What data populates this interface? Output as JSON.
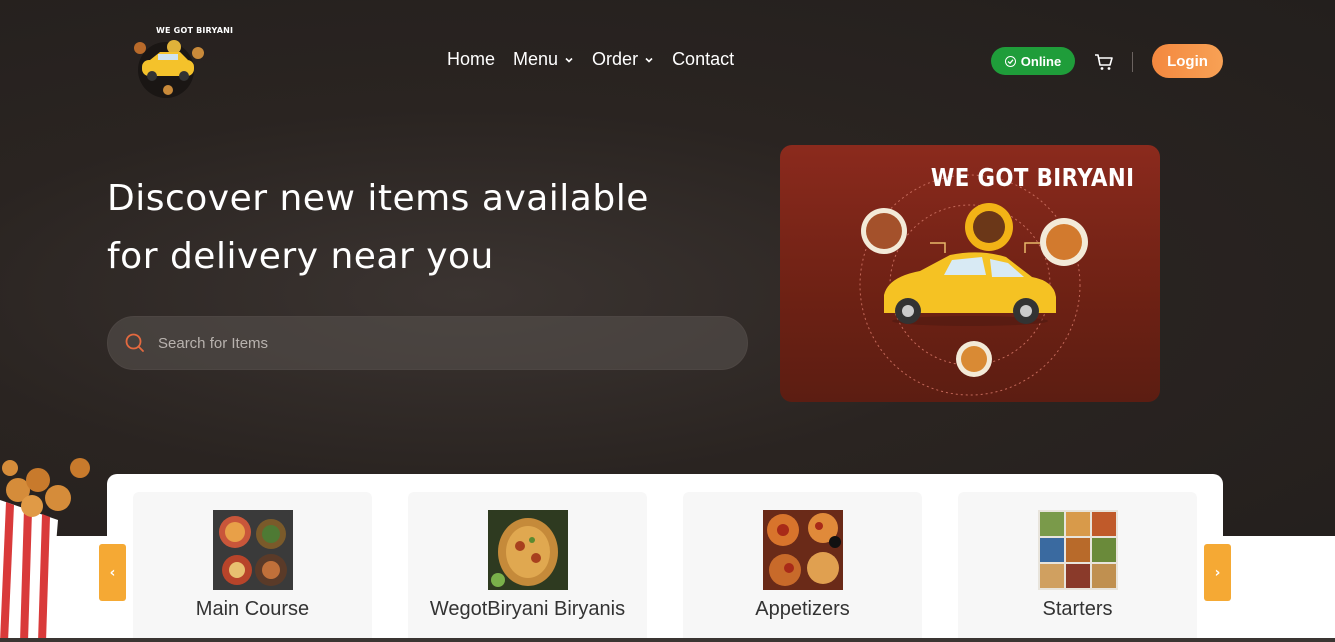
{
  "brand": {
    "logo_text": "WE GOT BIRYANI"
  },
  "nav": {
    "home": "Home",
    "menu": "Menu",
    "order": "Order",
    "contact": "Contact"
  },
  "status": {
    "online": "Online",
    "color": "#1f9d3a"
  },
  "header": {
    "login": "Login",
    "accent": "#f4883f"
  },
  "hero": {
    "headline_line1": "Discover new items available",
    "headline_line2": "for delivery near you"
  },
  "search": {
    "placeholder": "Search for Items",
    "value": ""
  },
  "banner": {
    "title": "WE GOT BIRYANI"
  },
  "categories": [
    {
      "label": "Main Course"
    },
    {
      "label": "WegotBiryani Biryanis"
    },
    {
      "label": "Appetizers"
    },
    {
      "label": "Starters"
    }
  ],
  "carousel": {
    "prev": "‹",
    "next": "›",
    "arrow_color": "#f5a934"
  }
}
